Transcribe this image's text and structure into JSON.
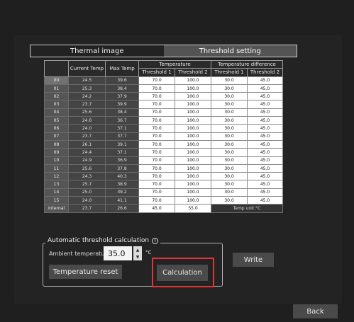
{
  "tabs": {
    "thermal": "Thermal image",
    "threshold": "Threshold setting"
  },
  "table": {
    "headers": {
      "current": "Current Temp",
      "max": "Max Temp",
      "temperature": "Temperature",
      "temp_diff": "Temperature difference",
      "t1": "Threshold 1",
      "t2": "Threshold 2",
      "td1": "Threshold 1",
      "td2": "Threshold 2"
    },
    "rows": [
      {
        "idx": "00",
        "current": "24.5",
        "max": "39.6",
        "t1": "70.0",
        "t2": "100.0",
        "d1": "30.0",
        "d2": "45.0"
      },
      {
        "idx": "01",
        "current": "25.3",
        "max": "38.4",
        "t1": "70.0",
        "t2": "100.0",
        "d1": "30.0",
        "d2": "45.0"
      },
      {
        "idx": "02",
        "current": "24.2",
        "max": "37.9",
        "t1": "70.0",
        "t2": "100.0",
        "d1": "30.0",
        "d2": "45.0"
      },
      {
        "idx": "03",
        "current": "23.7",
        "max": "39.9",
        "t1": "70.0",
        "t2": "100.0",
        "d1": "30.0",
        "d2": "45.0"
      },
      {
        "idx": "04",
        "current": "25.6",
        "max": "38.4",
        "t1": "70.0",
        "t2": "100.0",
        "d1": "30.0",
        "d2": "45.0"
      },
      {
        "idx": "05",
        "current": "24.6",
        "max": "36.7",
        "t1": "70.0",
        "t2": "100.0",
        "d1": "30.0",
        "d2": "45.0"
      },
      {
        "idx": "06",
        "current": "24.0",
        "max": "37.1",
        "t1": "70.0",
        "t2": "100.0",
        "d1": "30.0",
        "d2": "45.0"
      },
      {
        "idx": "07",
        "current": "23.7",
        "max": "37.7",
        "t1": "70.0",
        "t2": "100.0",
        "d1": "30.0",
        "d2": "45.0"
      },
      {
        "idx": "08",
        "current": "26.1",
        "max": "39.1",
        "t1": "70.0",
        "t2": "100.0",
        "d1": "30.0",
        "d2": "45.0"
      },
      {
        "idx": "09",
        "current": "24.4",
        "max": "37.1",
        "t1": "70.0",
        "t2": "100.0",
        "d1": "30.0",
        "d2": "45.0"
      },
      {
        "idx": "10",
        "current": "24.9",
        "max": "36.9",
        "t1": "70.0",
        "t2": "100.0",
        "d1": "30.0",
        "d2": "45.0"
      },
      {
        "idx": "11",
        "current": "25.6",
        "max": "37.8",
        "t1": "70.0",
        "t2": "100.0",
        "d1": "30.0",
        "d2": "45.0"
      },
      {
        "idx": "12",
        "current": "24.3",
        "max": "40.3",
        "t1": "70.0",
        "t2": "100.0",
        "d1": "30.0",
        "d2": "45.0"
      },
      {
        "idx": "13",
        "current": "25.7",
        "max": "38.9",
        "t1": "70.0",
        "t2": "100.0",
        "d1": "30.0",
        "d2": "45.0"
      },
      {
        "idx": "14",
        "current": "25.0",
        "max": "39.2",
        "t1": "70.0",
        "t2": "100.0",
        "d1": "30.0",
        "d2": "45.0"
      },
      {
        "idx": "15",
        "current": "24.0",
        "max": "41.1",
        "t1": "70.0",
        "t2": "100.0",
        "d1": "30.0",
        "d2": "45.0"
      }
    ],
    "internal": {
      "label": "Internal",
      "current": "23.7",
      "max": "26.6",
      "t1": "45.0",
      "t2": "55.0",
      "unit_note": "Temp unit:°C"
    }
  },
  "auto": {
    "title": "Automatic threshold calculation",
    "ambient_label": "Ambient temperature",
    "ambient_value": "35.0",
    "unit": "°C",
    "reset_label": "Temperature reset",
    "calc_label": "Calculation"
  },
  "buttons": {
    "write": "Write",
    "back": "Back"
  },
  "colors": {
    "highlight": "#e53434",
    "active_tab": "#545454"
  }
}
